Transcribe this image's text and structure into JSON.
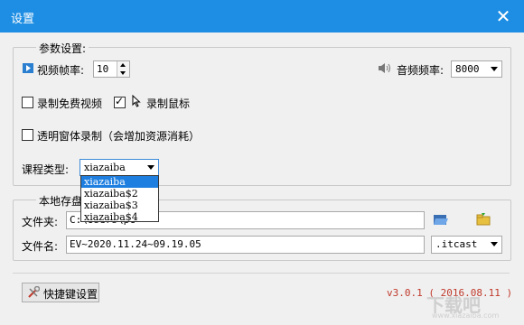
{
  "window": {
    "title": "设置",
    "close_glyph": "✕"
  },
  "params": {
    "legend": "参数设置:",
    "frame_rate_label": "视频帧率:",
    "frame_rate_value": "10",
    "audio_rate_label": "音频频率:",
    "audio_rate_value": "8000",
    "record_free_video_label": "录制免费视频",
    "record_free_video_checked": false,
    "record_mouse_label": "录制鼠标",
    "record_mouse_checked": true,
    "transparent_record_label": "透明窗体录制（会增加资源消耗）",
    "transparent_record_checked": false,
    "course_type_label": "课程类型:",
    "course_type_value": "xiazaiba",
    "course_type_options": [
      "xiazaiba",
      "xiazaiba$2",
      "xiazaiba$3",
      "xiazaiba$4"
    ]
  },
  "storage": {
    "legend": "本地存盘",
    "folder_label": "文件夹:",
    "folder_value": "C:\\Users\\pc",
    "filename_label": "文件名:",
    "filename_value": "EV~2020.11.24~09.19.05",
    "extension_value": ".itcast"
  },
  "footer": {
    "shortcut_button_label": "快捷键设置",
    "version_text": "v3.0.1 ( 2016.08.11 )"
  },
  "watermark": {
    "text": "下载吧",
    "url": "www.xiazaiba.com"
  },
  "icons": {
    "video": "video-icon",
    "speaker": "speaker-icon",
    "cursor": "cursor-icon",
    "folder_open": "folder-open-icon",
    "folder": "folder-icon",
    "shortcut": "tools-icon"
  }
}
